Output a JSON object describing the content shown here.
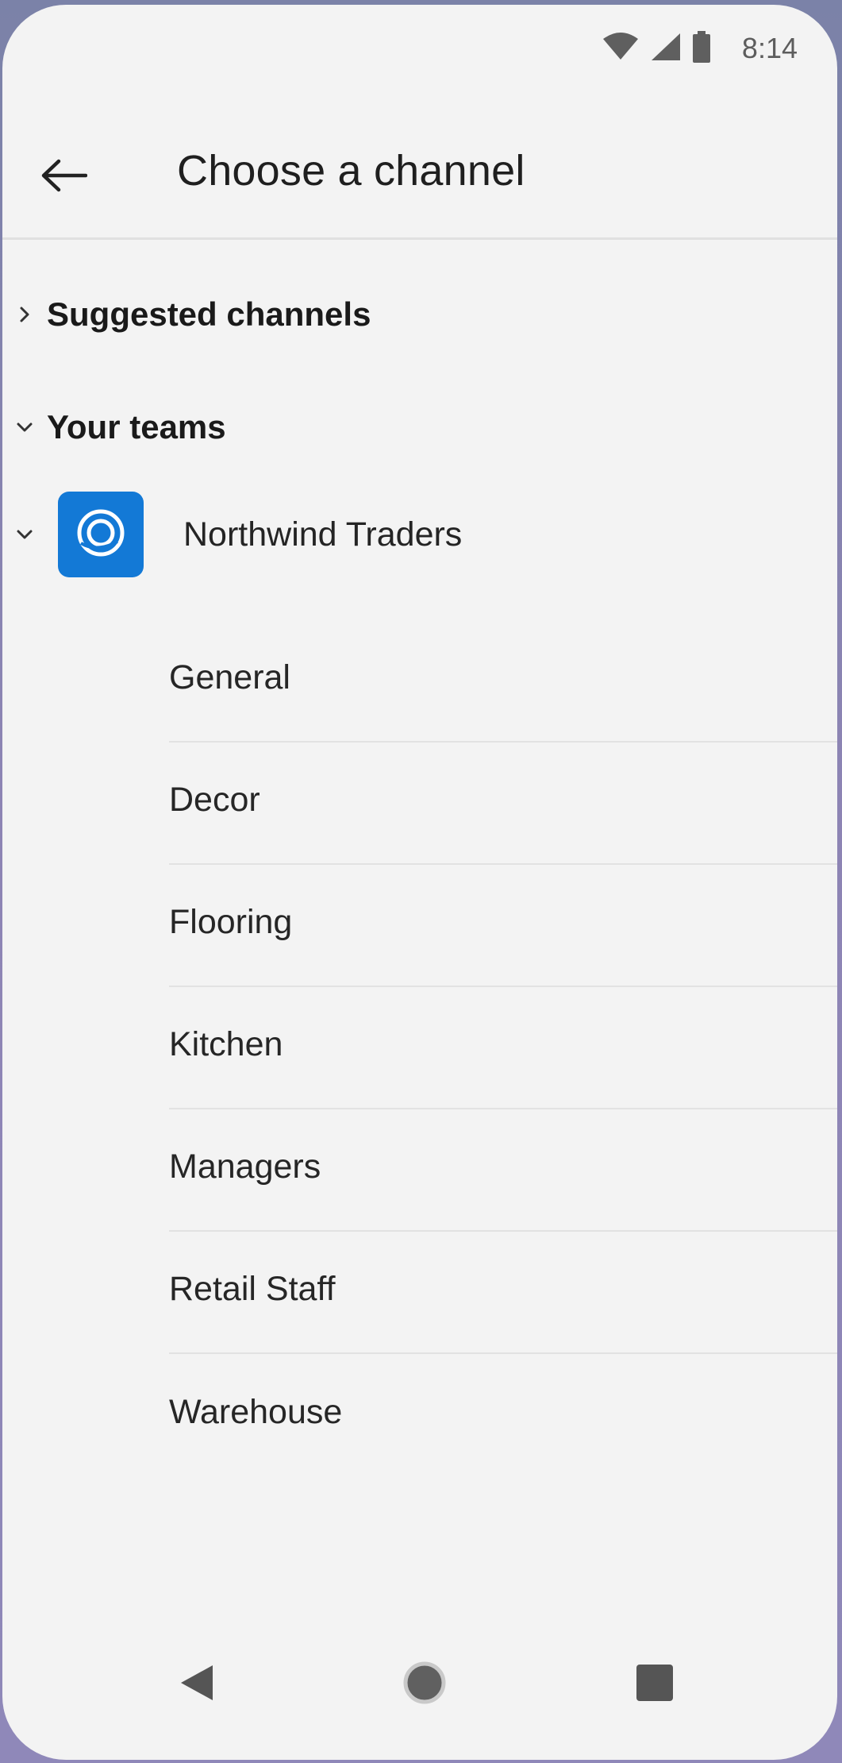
{
  "status_bar": {
    "time": "8:14",
    "icons": [
      "wifi-icon",
      "cellular-signal-icon",
      "battery-icon"
    ]
  },
  "header": {
    "back_icon": "arrow-left-icon",
    "title": "Choose a channel"
  },
  "sections": {
    "suggested": {
      "label": "Suggested channels",
      "state": "collapsed",
      "icon": "chevron-right-icon"
    },
    "your_teams": {
      "label": "Your teams",
      "state": "expanded",
      "icon": "chevron-down-icon"
    }
  },
  "team": {
    "name": "Northwind Traders",
    "state": "expanded",
    "avatar_color": "#1379d6",
    "avatar_icon": "northwind-logo-icon"
  },
  "channels": [
    {
      "label": "General"
    },
    {
      "label": "Decor"
    },
    {
      "label": "Flooring"
    },
    {
      "label": "Kitchen"
    },
    {
      "label": "Managers"
    },
    {
      "label": "Retail Staff"
    },
    {
      "label": "Warehouse"
    }
  ],
  "nav_bar": {
    "icons": [
      "back-triangle-icon",
      "home-circle-icon",
      "recents-square-icon"
    ]
  }
}
